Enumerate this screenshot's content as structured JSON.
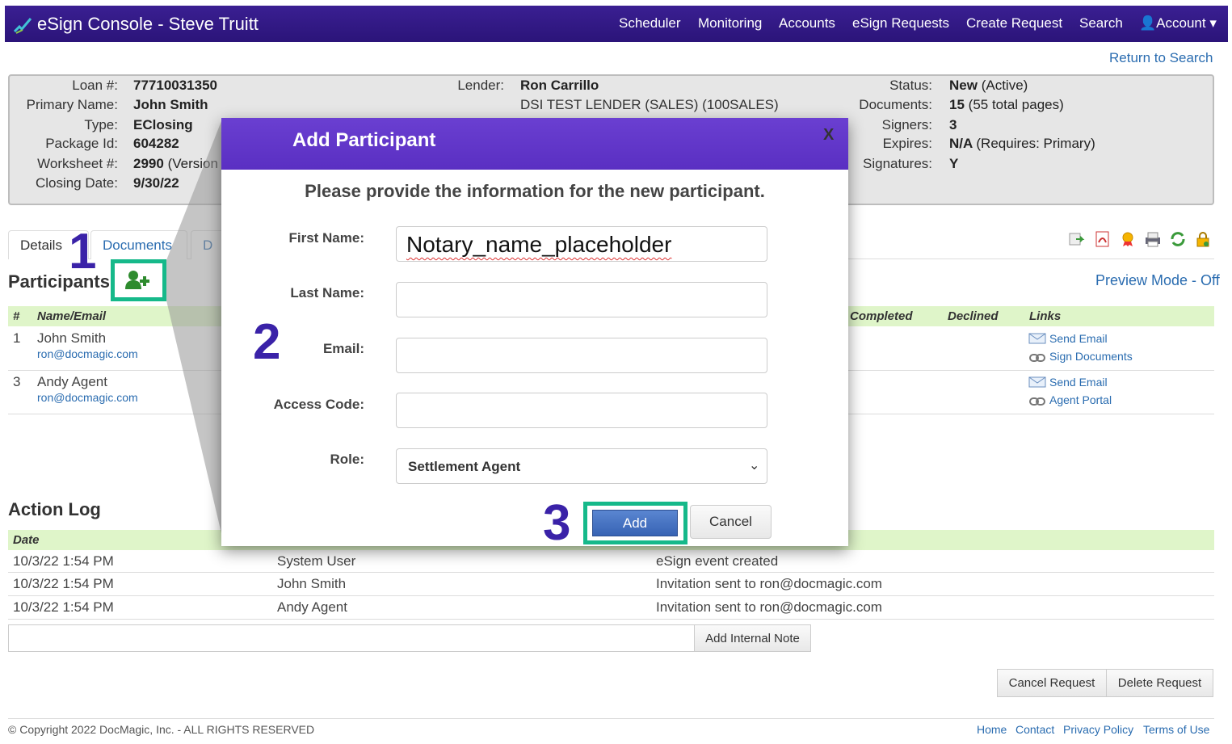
{
  "navbar": {
    "title": "eSign Console - Steve Truitt",
    "items": [
      "Scheduler",
      "Monitoring",
      "Accounts",
      "eSign Requests",
      "Create Request",
      "Search"
    ],
    "account_label": "Account"
  },
  "return_link": "Return to Search",
  "summary": {
    "left_labels": [
      "Loan #:",
      "Primary Name:",
      "Type:",
      "Package Id:",
      "Worksheet #:",
      "Closing Date:"
    ],
    "left_values": [
      "77710031350",
      "John Smith",
      "EClosing",
      "604282",
      "2990",
      "9/30/22"
    ],
    "worksheet_suffix": "(Version",
    "lender_label": "Lender:",
    "lender_name": "Ron Carrillo",
    "lender_company": "DSI TEST LENDER (SALES) (100SALES)",
    "right_labels": [
      "Status:",
      "Documents:",
      "Signers:",
      "Expires:",
      "Signatures:"
    ],
    "right_values_bold": [
      "New",
      "15",
      "3",
      "N/A",
      "Y"
    ],
    "right_values_thin": [
      "(Active)",
      "(55 total pages)",
      "",
      "(Requires: Primary)",
      ""
    ]
  },
  "tabs": [
    "Details",
    "Documents",
    "D"
  ],
  "participants": {
    "title": "Participants",
    "preview_mode": "Preview Mode - Off",
    "headers": {
      "num": "#",
      "name": "Name/Email",
      "completed": "Completed",
      "declined": "Declined",
      "links": "Links"
    },
    "rows": [
      {
        "num": "1",
        "name": "John Smith",
        "email": "ron@docmagic.com",
        "link1": "Send Email",
        "link2": "Sign Documents"
      },
      {
        "num": "3",
        "name": "Andy Agent",
        "email": "ron@docmagic.com",
        "link1": "Send Email",
        "link2": "Agent Portal"
      }
    ]
  },
  "action_log": {
    "title": "Action Log",
    "date_header": "Date",
    "rows": [
      {
        "date": "10/3/22 1:54 PM",
        "user": "System User",
        "event": "eSign event created"
      },
      {
        "date": "10/3/22 1:54 PM",
        "user": "John Smith",
        "event": "Invitation sent to ron@docmagic.com"
      },
      {
        "date": "10/3/22 1:54 PM",
        "user": "Andy Agent",
        "event": "Invitation sent to ron@docmagic.com"
      }
    ],
    "add_note_label": "Add Internal Note"
  },
  "actions": {
    "cancel_request": "Cancel Request",
    "delete_request": "Delete Request"
  },
  "footer": {
    "copyright": "© Copyright 2022 DocMagic, Inc. - ALL RIGHTS RESERVED",
    "links": [
      "Home",
      "Contact",
      "Privacy Policy",
      "Terms of Use"
    ]
  },
  "modal": {
    "title": "Add Participant",
    "close": "X",
    "intro": "Please provide the information for the new participant.",
    "first_name_label": "First Name:",
    "first_name_value": "Notary_name_placeholder",
    "last_name_label": "Last Name:",
    "email_label": "Email:",
    "access_code_label": "Access Code:",
    "role_label": "Role:",
    "role_value": "Settlement Agent",
    "add_label": "Add",
    "cancel_label": "Cancel"
  },
  "steps": [
    "1",
    "2",
    "3"
  ],
  "colors": {
    "navbar": "#2f1780",
    "modal_header": "#5f33c8",
    "highlight": "#16b98a",
    "step_number": "#3a22a8",
    "table_header": "#dff5c9"
  }
}
